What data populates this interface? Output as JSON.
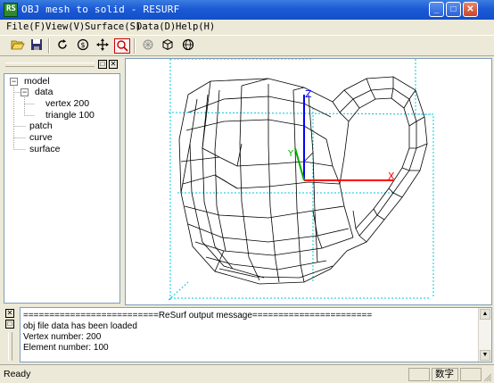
{
  "window": {
    "title": "OBJ mesh to solid - RESURF",
    "icon_label": "RS"
  },
  "menu": [
    {
      "label": "File(F)"
    },
    {
      "label": "View(V)"
    },
    {
      "label": "Surface(S)"
    },
    {
      "label": "Data(D)"
    },
    {
      "label": "Help(H)"
    }
  ],
  "toolbar": [
    {
      "name": "open-icon"
    },
    {
      "name": "save-icon"
    },
    {
      "name": "rotate-icon"
    },
    {
      "name": "pan-icon"
    },
    {
      "name": "move-icon"
    },
    {
      "name": "zoom-window-icon"
    },
    {
      "name": "mesh-icon"
    },
    {
      "name": "box-icon"
    },
    {
      "name": "sphere-icon"
    }
  ],
  "tree": {
    "nodes": [
      {
        "label": "model"
      },
      {
        "label": "data"
      },
      {
        "label": "vertex 200"
      },
      {
        "label": "triangle 100"
      },
      {
        "label": "patch"
      },
      {
        "label": "curve"
      },
      {
        "label": "surface"
      }
    ]
  },
  "viewport": {
    "axes": {
      "x": "X",
      "y": "Y",
      "z": "Z"
    },
    "colors": {
      "x_axis": "#ff0000",
      "y_axis": "#00b000",
      "z_axis": "#0000ff",
      "bbox": "#00c8d8",
      "mesh": "#000000"
    }
  },
  "output": {
    "lines": [
      "==========================ReSurf output message=======================",
      "obj file data has been loaded",
      "Vertex number: 200",
      "Element number: 100"
    ]
  },
  "status": {
    "ready": "Ready",
    "num_indicator": "数字"
  }
}
